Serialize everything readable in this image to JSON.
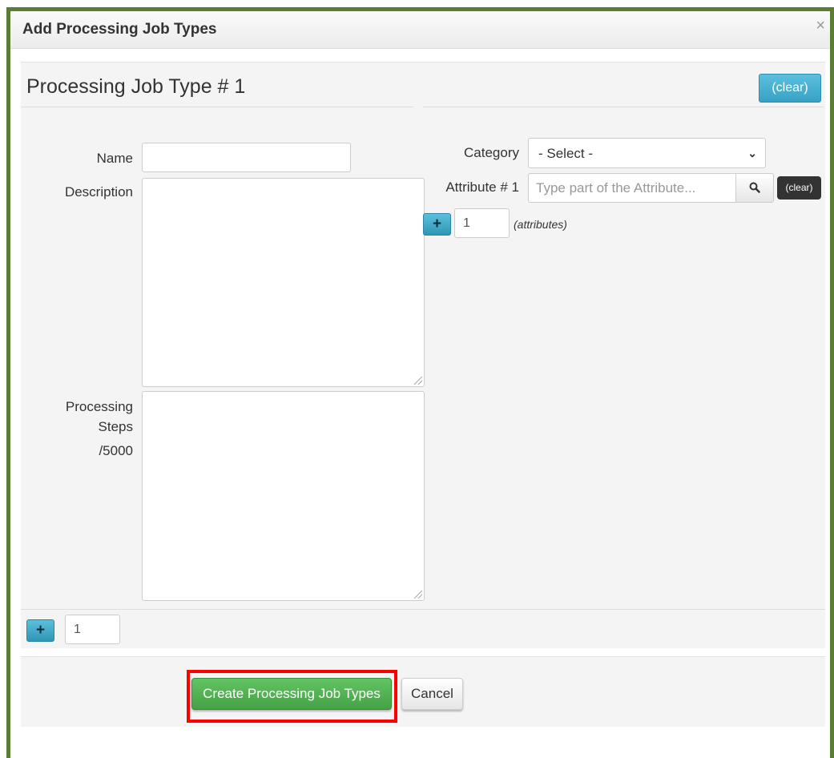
{
  "modal": {
    "title": "Add Processing Job Types",
    "close_icon": "×"
  },
  "job": {
    "title": "Processing Job Type # 1",
    "clear_label": "(clear)"
  },
  "form": {
    "name_label": "Name",
    "name_value": "",
    "description_label": "Description",
    "description_value": "",
    "steps_label_line1": "Processing",
    "steps_label_line2": "Steps",
    "steps_counter": "/5000",
    "steps_value": "",
    "category_label": "Category",
    "category_selected": "- Select -",
    "attribute_label": "Attribute # 1",
    "attribute_placeholder": "Type part of the Attribute...",
    "attribute_clear_label": "(clear)",
    "attribute_count": "1",
    "attribute_note": "(attributes)",
    "job_count": "1"
  },
  "footer": {
    "create_label": "Create Processing Job Types",
    "cancel_label": "Cancel"
  },
  "colors": {
    "frame_border": "#5a7d35",
    "info_button": "#5bc0de",
    "success_button": "#5cb85c",
    "highlight": "#ff0000"
  }
}
